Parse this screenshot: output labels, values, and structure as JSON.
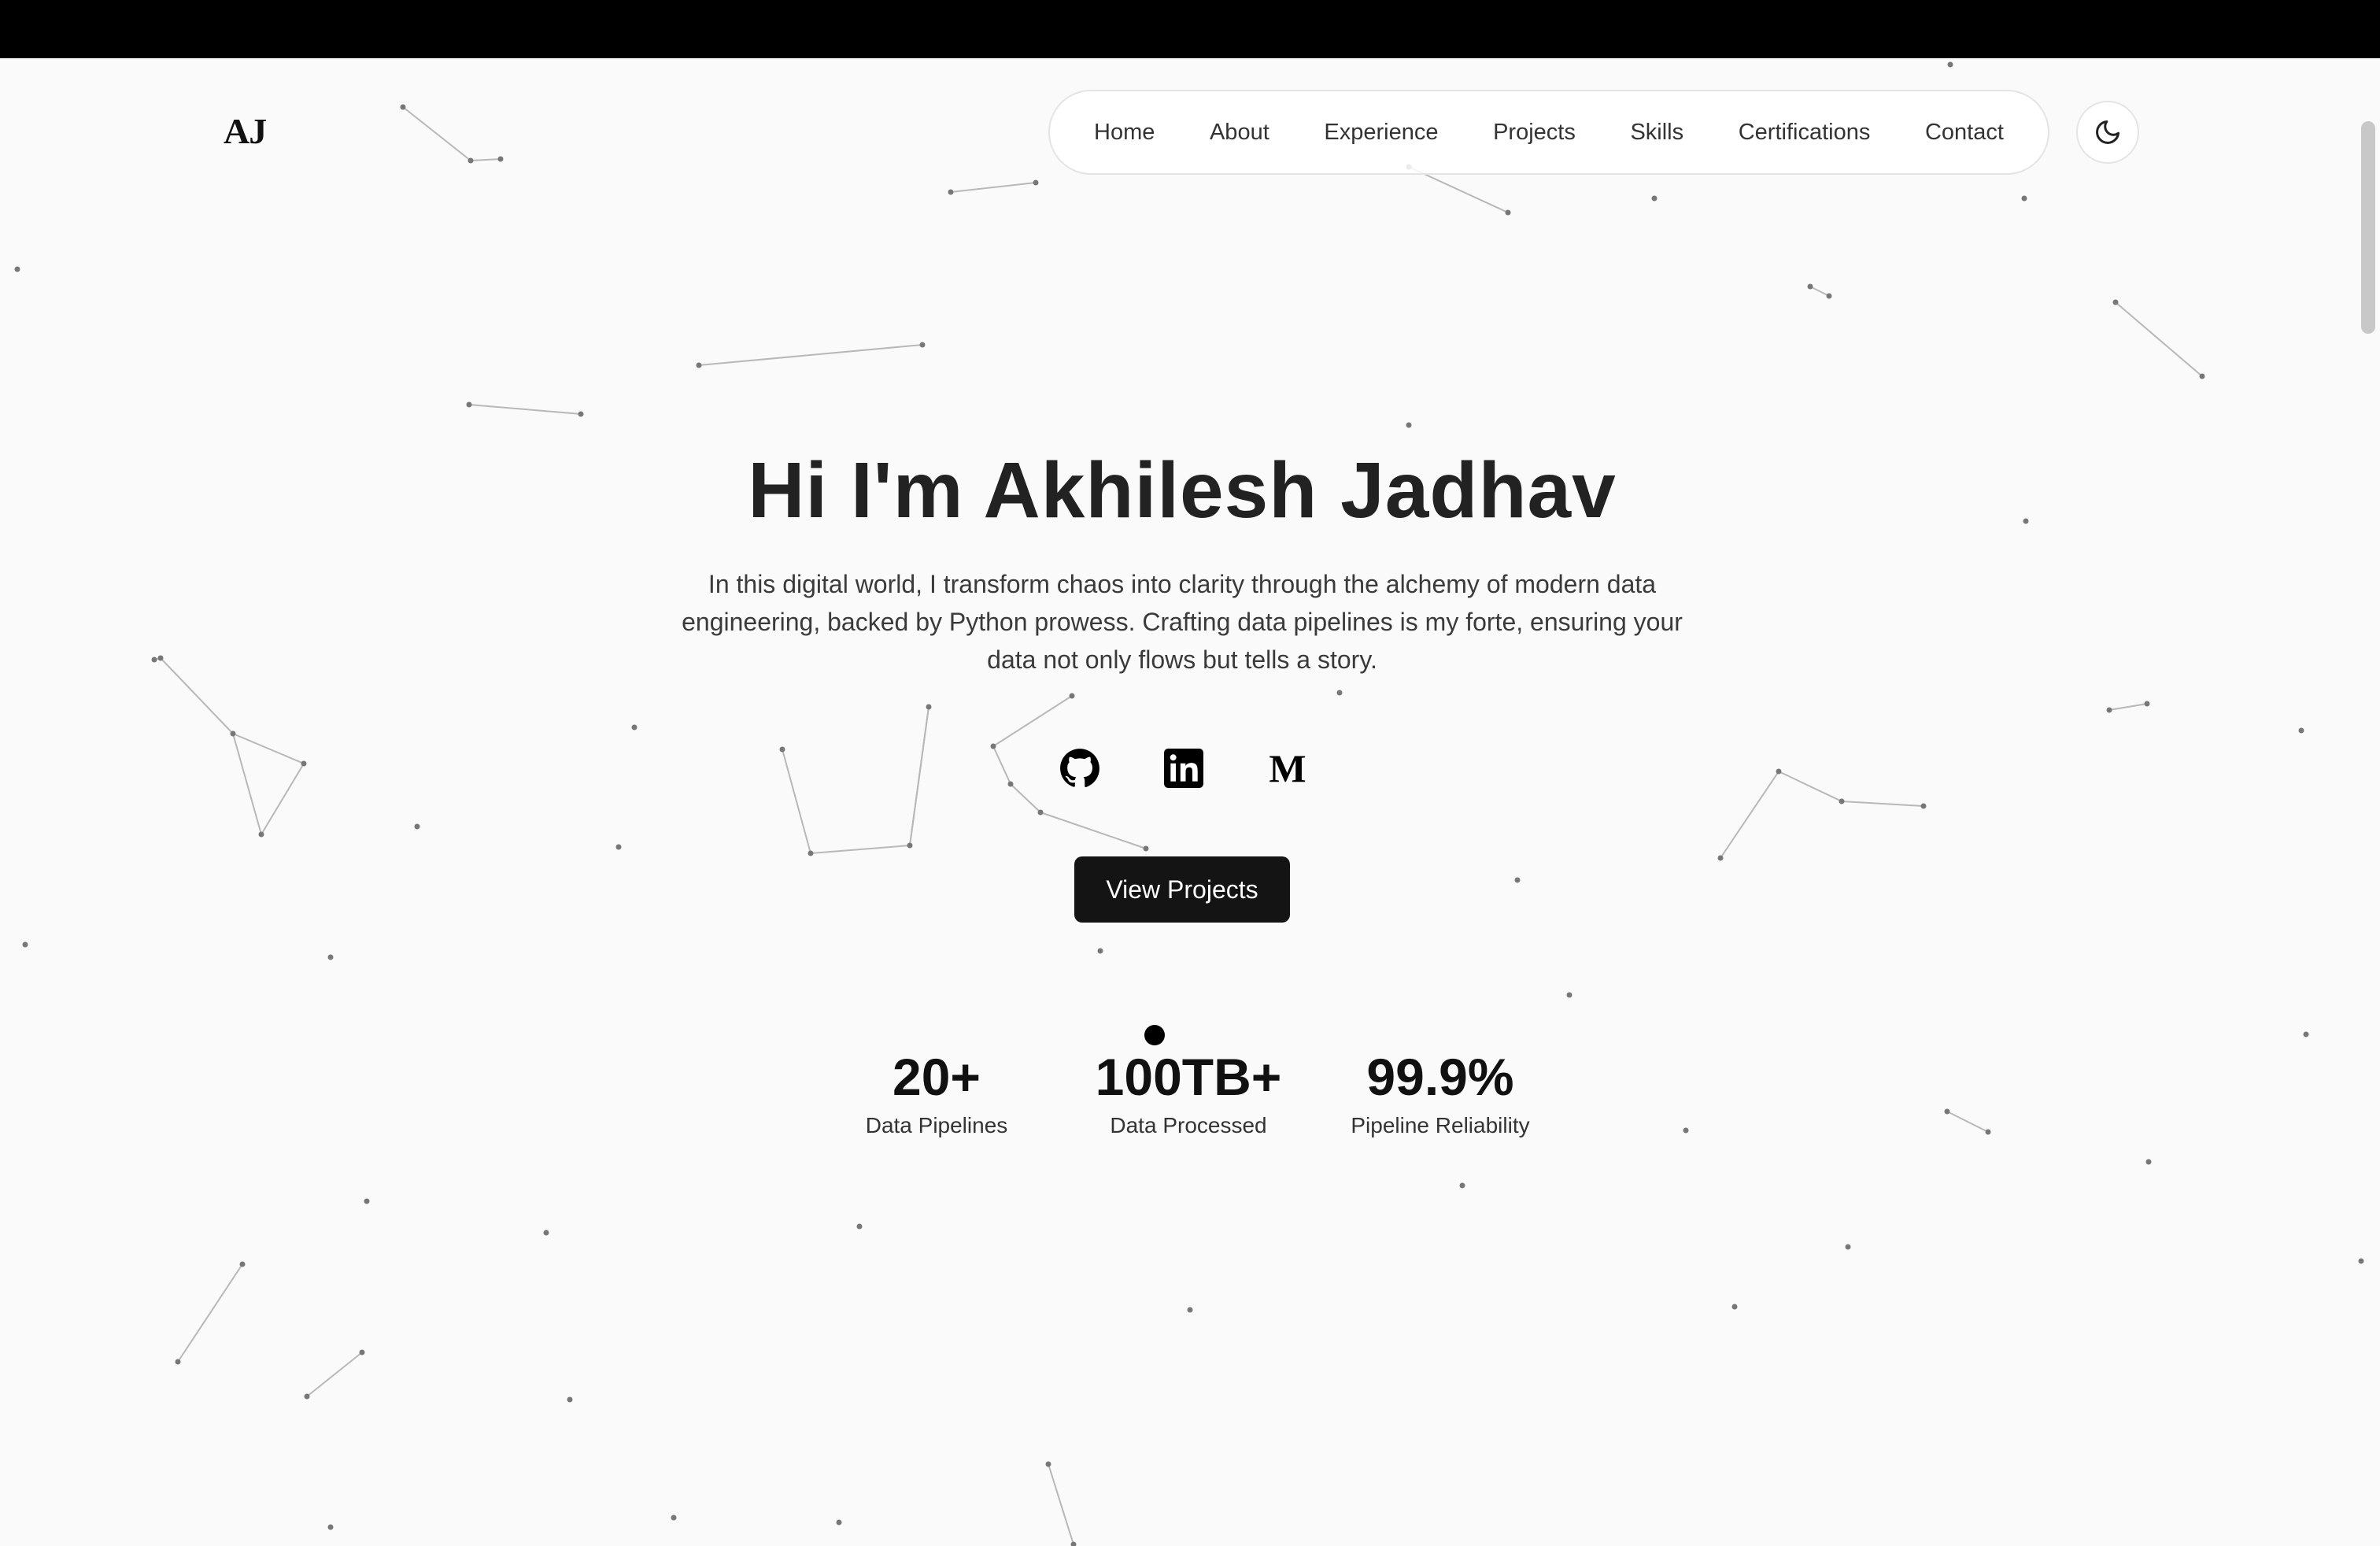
{
  "logo": "AJ",
  "nav": {
    "items": [
      "Home",
      "About",
      "Experience",
      "Projects",
      "Skills",
      "Certifications",
      "Contact"
    ]
  },
  "theme_toggle": {
    "icon": "moon-icon"
  },
  "hero": {
    "title": "Hi I'm Akhilesh Jadhav",
    "description": "In this digital world, I transform chaos into clarity through the alchemy of modern data engineering, backed by Python prowess. Crafting data pipelines is my forte, ensuring your data not only flows but tells a story.",
    "socials": [
      {
        "name": "GitHub",
        "icon": "github-icon"
      },
      {
        "name": "LinkedIn",
        "icon": "linkedin-icon",
        "glyph": "in"
      },
      {
        "name": "Medium",
        "icon": "medium-icon",
        "glyph": "M"
      }
    ],
    "cta_label": "View Projects"
  },
  "stats": [
    {
      "value": "20+",
      "label": "Data Pipelines"
    },
    {
      "value": "100TB+",
      "label": "Data Processed"
    },
    {
      "value": "99.9%",
      "label": "Pipeline Reliability"
    }
  ],
  "colors": {
    "background": "#fafafa",
    "accent": "#141414",
    "particle": "#777777"
  }
}
